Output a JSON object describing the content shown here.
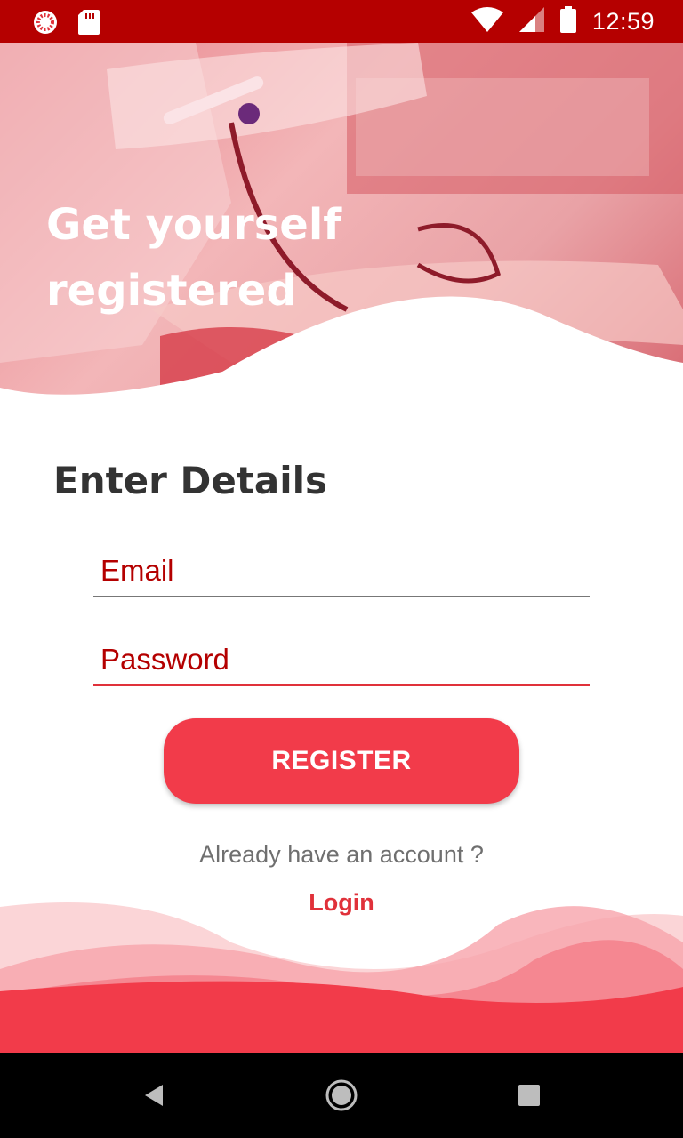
{
  "status_bar": {
    "time": "12:59",
    "background": "#b50000",
    "icons": [
      "notification-ring-icon",
      "sd-card-icon",
      "wifi-icon",
      "cell-signal-icon",
      "battery-icon"
    ]
  },
  "hero": {
    "title": "Get yourself registered"
  },
  "form": {
    "heading": "Enter Details",
    "email_placeholder": "Email",
    "password_placeholder": "Password",
    "register_label": "REGISTER"
  },
  "footer": {
    "account_prompt": "Already have an account ?",
    "login_label": "Login"
  },
  "nav_bar": {
    "icons": [
      "back-icon",
      "home-icon",
      "recents-icon"
    ]
  },
  "colors": {
    "accent": "#f23b4a",
    "label_red": "#b40000",
    "underline_active": "#e0313a"
  }
}
